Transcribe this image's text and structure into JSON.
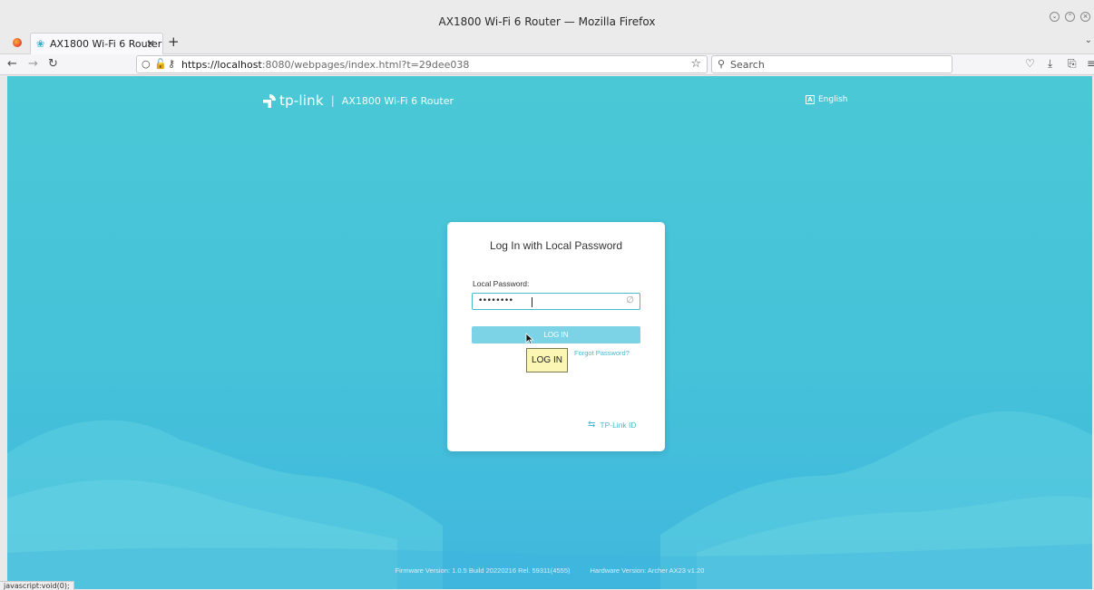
{
  "window": {
    "title": "AX1800 Wi-Fi 6 Router — Mozilla Firefox"
  },
  "tab": {
    "title": "AX1800 Wi-Fi 6 Router",
    "close": "×",
    "new_tab": "+"
  },
  "navbar": {
    "url_host": "https://localhost",
    "url_rest": ":8080/webpages/index.html?t=29dee038",
    "search_placeholder": "Search"
  },
  "header": {
    "brand": "tp-link",
    "separator": "|",
    "model": "AX1800 Wi-Fi 6 Router",
    "language": "English"
  },
  "login": {
    "title": "Log In with Local Password",
    "password_label": "Local Password:",
    "password_value": "••••••••",
    "login_button": "LOG IN",
    "forgot_link": "Forgot Password?",
    "tplink_id_link": "TP-Link ID"
  },
  "tooltip": {
    "text": "LOG IN"
  },
  "footer": {
    "firmware": "Firmware Version: 1.0.5 Build 20220216 Rel. 59311(4555)",
    "hardware": "Hardware Version: Archer AX23 v1.20"
  },
  "status_bar": {
    "text": "javascript:void(0);"
  },
  "colors": {
    "accent": "#4ab8cf",
    "button": "#7dd3e6",
    "background_top": "#4ac8d6",
    "background_bottom": "#3fb7de"
  }
}
